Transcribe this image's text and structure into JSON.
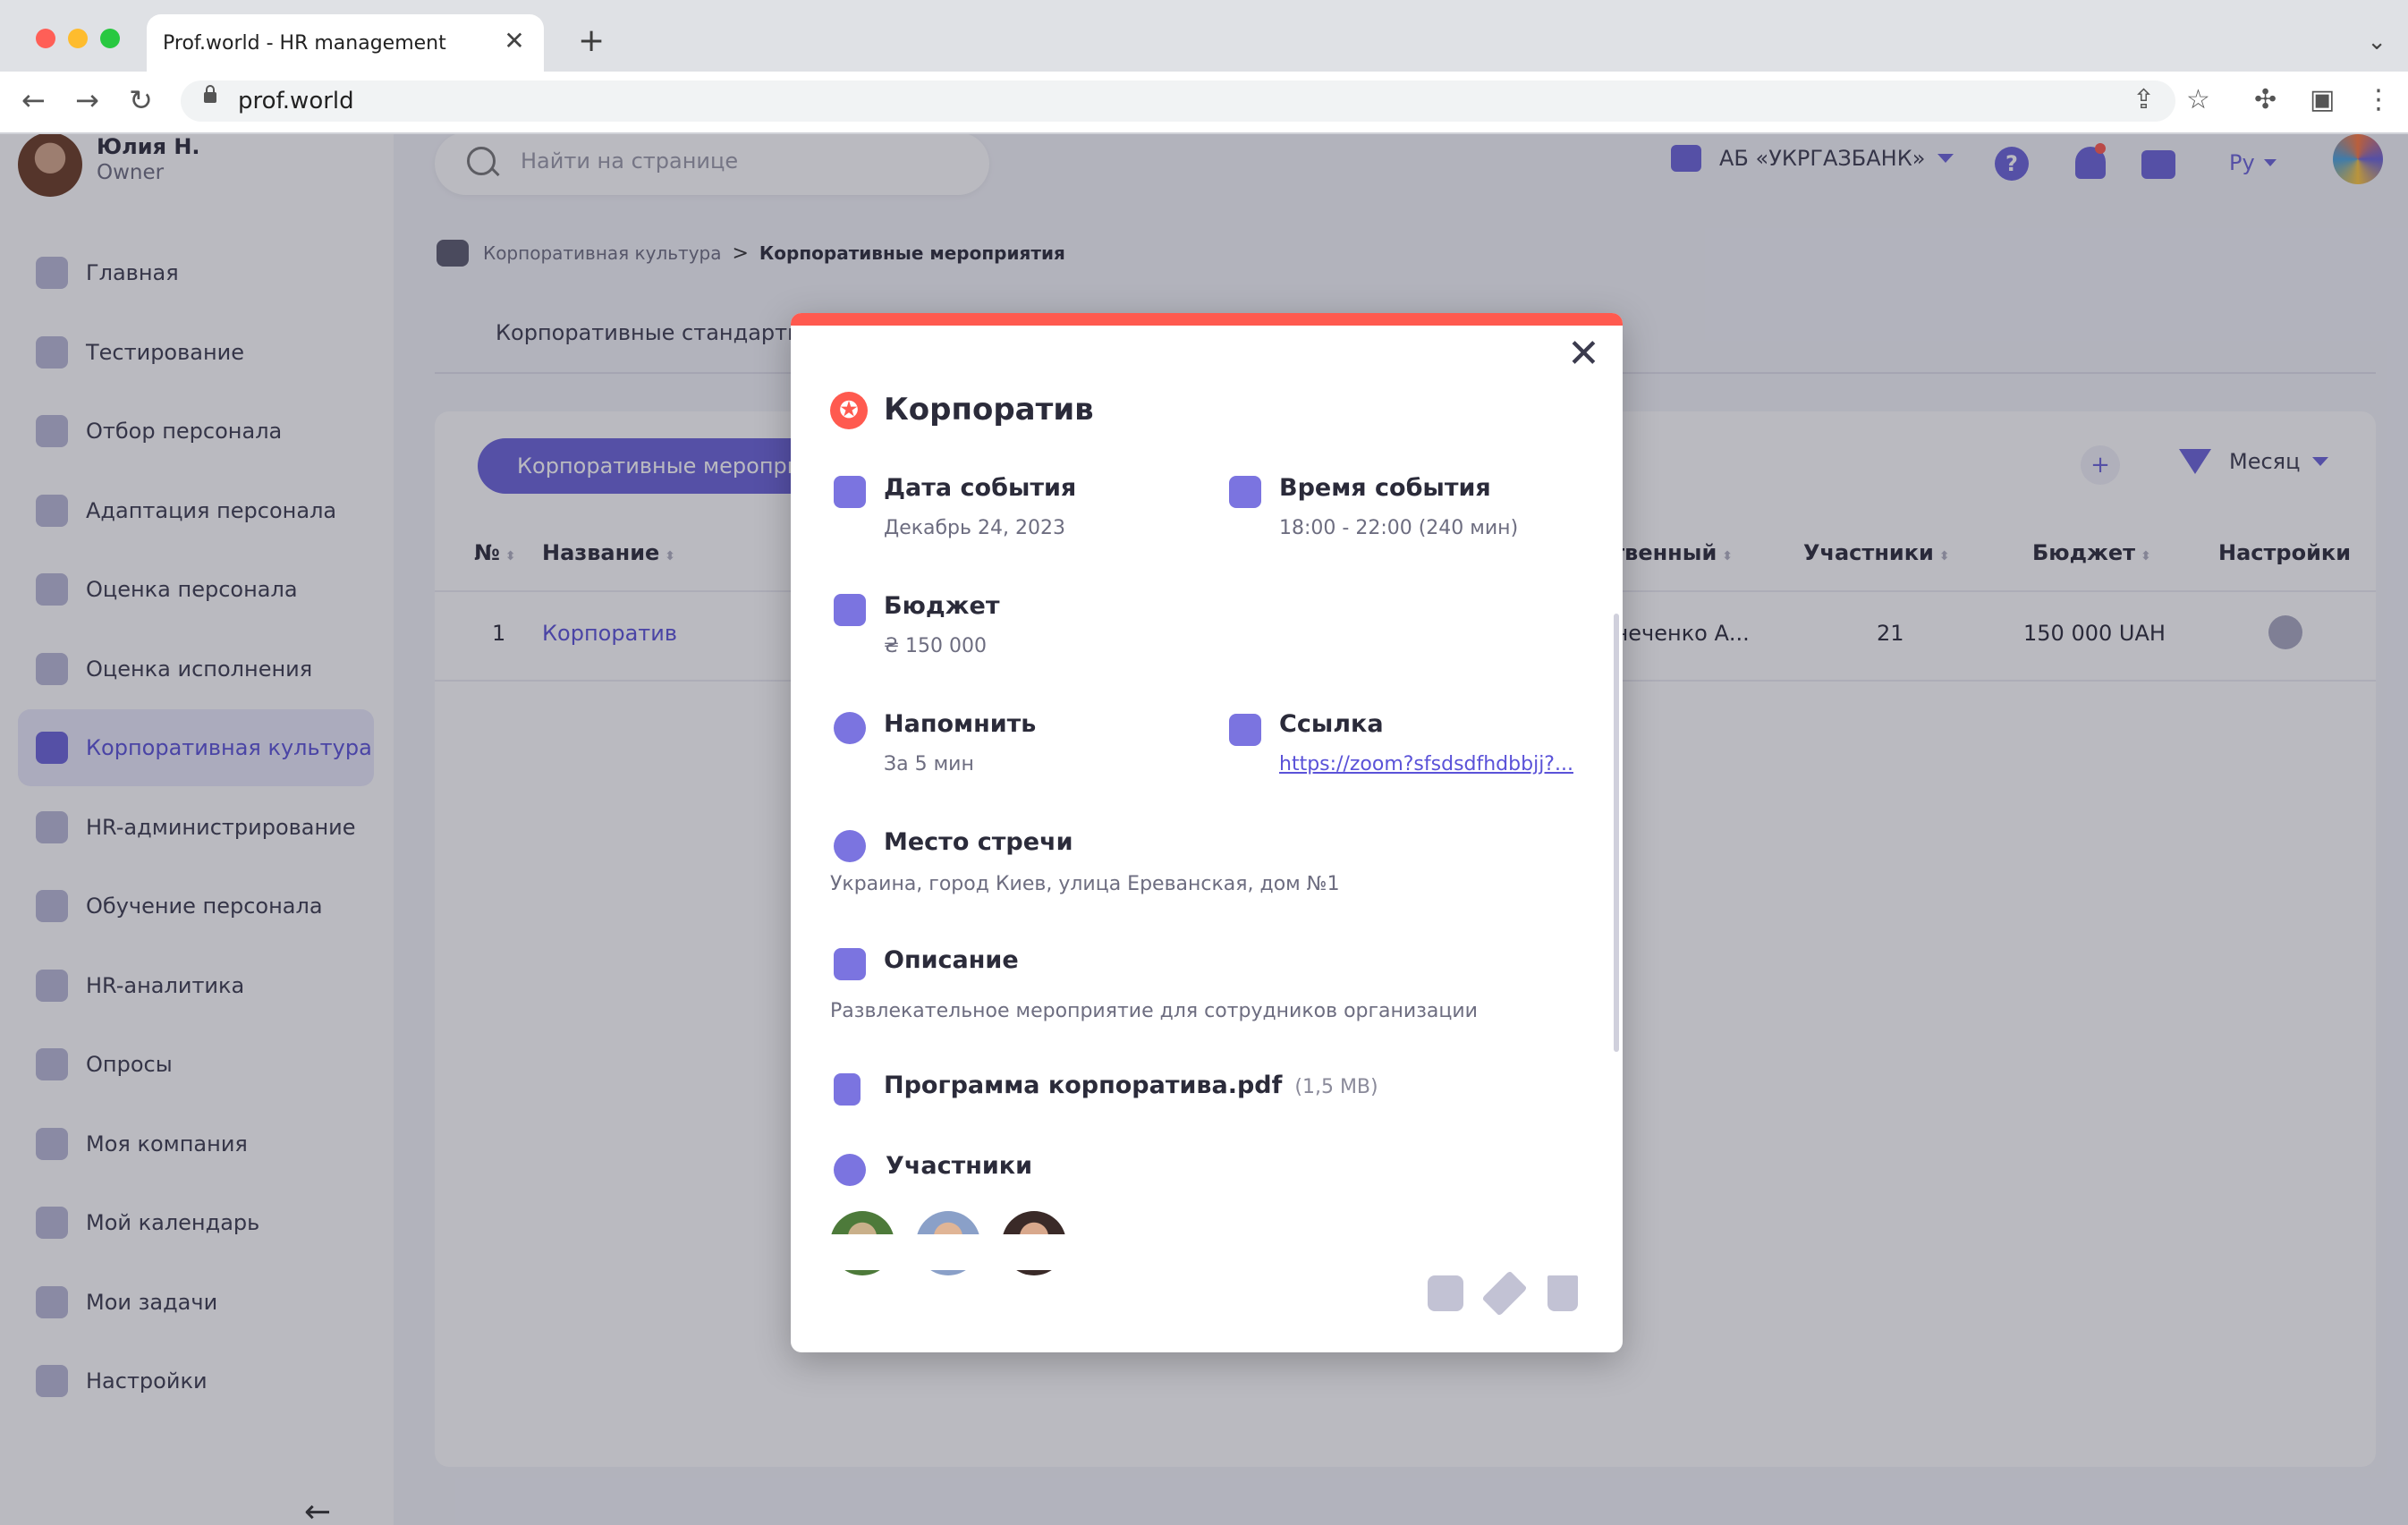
{
  "browser": {
    "tab_title": "Prof.world  - HR management",
    "tab_close": "✕",
    "new_tab": "+",
    "tab_menu": "⌄",
    "back": "←",
    "forward": "→",
    "reload": "↻",
    "url": "prof.world",
    "share": "⇪",
    "star": "☆",
    "extensions": "✣",
    "sidepanel": "▣",
    "more": "⋮"
  },
  "user": {
    "name": "Юлия Н.",
    "role": "Owner"
  },
  "sidebar": {
    "items": [
      {
        "label": "Главная",
        "icon": "home-icon"
      },
      {
        "label": "Тестирование",
        "icon": "clipboard-icon"
      },
      {
        "label": "Отбор персонала",
        "icon": "people-icon"
      },
      {
        "label": "Адаптация персонала",
        "icon": "heart-icon"
      },
      {
        "label": "Оценка персонала",
        "icon": "user-rating-icon"
      },
      {
        "label": "Оценка исполнения",
        "icon": "user-icon"
      },
      {
        "label": "Корпоративная культура",
        "icon": "gamepad-icon",
        "active": true
      },
      {
        "label": "HR-администрирование",
        "icon": "sliders-icon"
      },
      {
        "label": "Обучение персонала",
        "icon": "graduation-icon"
      },
      {
        "label": "HR-аналитика",
        "icon": "chart-icon"
      },
      {
        "label": "Опросы",
        "icon": "survey-icon"
      },
      {
        "label": "Моя компания",
        "icon": "briefcase-icon"
      },
      {
        "label": "Мой календарь",
        "icon": "calendar-icon"
      },
      {
        "label": "Мои задачи",
        "icon": "checkbox-icon"
      },
      {
        "label": "Настройки",
        "icon": "gear-icon"
      }
    ],
    "collapse": "←"
  },
  "header": {
    "search_placeholder": "Найти на странице",
    "org": "АБ «УКРГАЗБАНК»",
    "help": "?",
    "lang": "Ру"
  },
  "breadcrumb": {
    "parent": "Корпоративная культура",
    "sep": ">",
    "current": "Корпоративные мероприятия"
  },
  "tabs": {
    "first": "Корпоративные стандарты"
  },
  "card": {
    "pill": "Корпоративные мероприятия",
    "plus": "+",
    "filter": "Месяц"
  },
  "table": {
    "headers": {
      "num": "№",
      "name": "Название",
      "responsible": "ственный",
      "participants": "Участники",
      "budget": "Бюджет",
      "settings": "Настройки"
    },
    "sort_glyph": "⬍",
    "rows": [
      {
        "num": "1",
        "name": "Корпоратив",
        "responsible": "днеченко А...",
        "participants": "21",
        "budget": "150 000 UAH"
      }
    ]
  },
  "modal": {
    "close": "✕",
    "title_icon": "✪",
    "title": "Корпоратив",
    "date_label": "Дата события",
    "date_value": "Декабрь 24, 2023",
    "time_label": "Время события",
    "time_value": "18:00 - 22:00 (240 мин)",
    "budget_label": "Бюджет",
    "budget_value": "₴ 150 000",
    "remind_label": "Напомнить",
    "remind_value": "За 5 мин",
    "link_label": "Ссылка",
    "link_value": "https://zoom?sfsdsdfhdbbjj?...",
    "place_label": "Место стречи",
    "place_value": "Украина, город Киев, улица Ереванская, дом №1",
    "desc_label": "Описание",
    "desc_value": "Развлекательное мероприятие для сотрудников организации",
    "file_name": "Программа корпоратива.pdf",
    "file_size": "(1,5 MB)",
    "participants_label": "Участники"
  },
  "colors": {
    "accent": "#6a63d9",
    "danger": "#ff5a4f"
  }
}
